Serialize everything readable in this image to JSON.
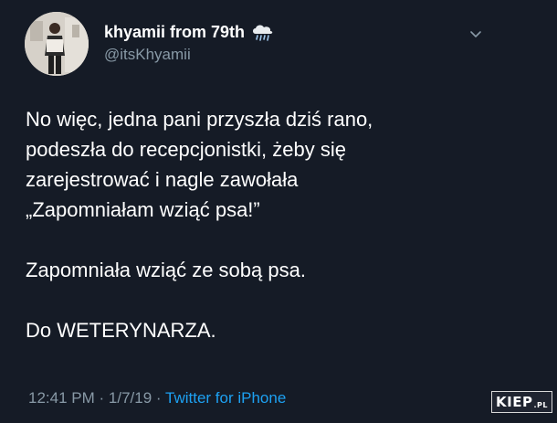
{
  "author": {
    "display_name": "khyamii from 79th",
    "handle": "@itsKhyamii",
    "name_emoji_icon": "cloud-with-rain-icon",
    "avatar_icon": "profile-photo-avatar"
  },
  "tweet": {
    "paragraph1_lines": [
      "No więc, jedna pani przyszła dziś rano,",
      "podeszła do recepcjonistki, żeby się",
      "zarejestrować i nagle zawołała",
      "„Zapomniałam wziąć psa!”"
    ],
    "paragraph2": "Zapomniała wziąć ze sobą psa.",
    "paragraph3": "Do WETERYNARZA."
  },
  "meta": {
    "time": "12:41 PM",
    "separator": "·",
    "date": "1/7/19",
    "source": "Twitter for iPhone"
  },
  "watermark": {
    "main": "KIEP",
    "suffix": ".PL"
  },
  "colors": {
    "background": "#151b26",
    "primary_text": "#ffffff",
    "secondary_text": "#8899a6",
    "link": "#1da1f2"
  }
}
